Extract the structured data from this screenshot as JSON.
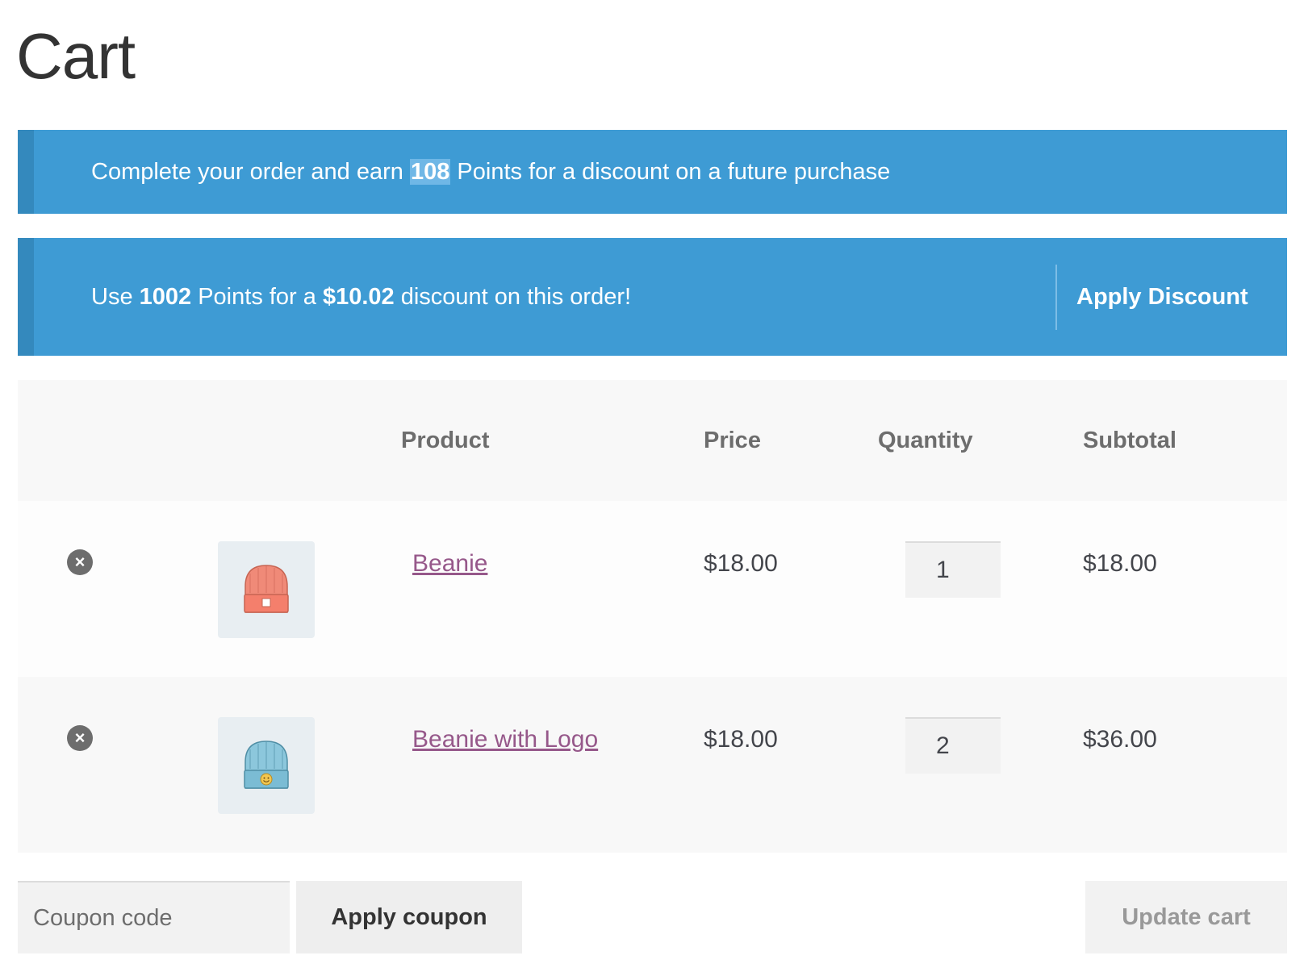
{
  "page": {
    "title": "Cart"
  },
  "notices": {
    "earn": {
      "prefix": "Complete your order and earn ",
      "points": "108",
      "suffix": " Points for a discount on a future purchase"
    },
    "redeem": {
      "prefix": "Use ",
      "points": "1002",
      "middle": " Points for a ",
      "amount": "$10.02",
      "suffix": " discount on this order!",
      "button_label": "Apply Discount"
    },
    "colors": {
      "background": "#3e9bd4",
      "accent_bar": "#3489bd"
    }
  },
  "cart": {
    "columns": [
      "",
      "",
      "Product",
      "Price",
      "Quantity",
      "Subtotal"
    ],
    "items": [
      {
        "name": "Beanie",
        "price": "$18.00",
        "quantity": "1",
        "subtotal": "$18.00",
        "thumbnail_icon": "orange-beanie-image"
      },
      {
        "name": "Beanie with Logo",
        "price": "$18.00",
        "quantity": "2",
        "subtotal": "$36.00",
        "thumbnail_icon": "blue-beanie-logo-image"
      }
    ],
    "remove_icon": "remove-icon",
    "link_color": "#96588a"
  },
  "actions": {
    "coupon_placeholder": "Coupon code",
    "coupon_value": "",
    "apply_coupon_label": "Apply coupon",
    "update_cart_label": "Update cart"
  }
}
